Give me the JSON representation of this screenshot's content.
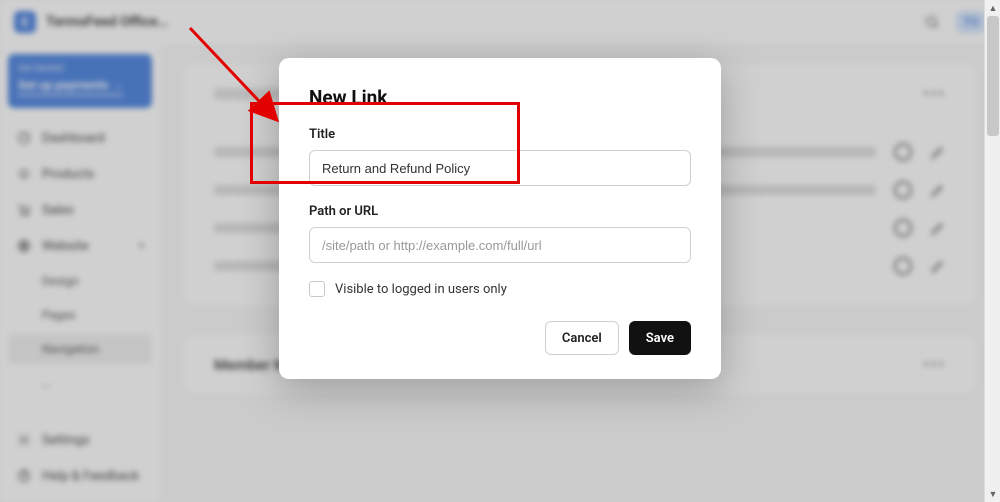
{
  "app": {
    "badge_letter": "E",
    "title": "TermsFeed Office…"
  },
  "promo": {
    "pre": "Get Started",
    "main": "Set up payments  →"
  },
  "sidebar": {
    "items": [
      {
        "label": "Dashboard"
      },
      {
        "label": "Products"
      },
      {
        "label": "Sales"
      },
      {
        "label": "Website"
      },
      {
        "label": "Design"
      },
      {
        "label": "Pages"
      },
      {
        "label": "Navigation"
      },
      {
        "label": "…"
      },
      {
        "label": "Settings"
      },
      {
        "label": "Help & Feedback"
      }
    ]
  },
  "cards": {
    "section2_title": "Member Menu",
    "dots": "•••"
  },
  "modal": {
    "heading": "New Link",
    "title_label": "Title",
    "title_value": "Return and Refund Policy",
    "path_label": "Path or URL",
    "path_placeholder": "/site/path or http://example.com/full/url",
    "checkbox_label": "Visible to logged in users only",
    "cancel": "Cancel",
    "save": "Save"
  },
  "colors": {
    "accent": "#2f6fdb",
    "annotation": "#e30000"
  }
}
